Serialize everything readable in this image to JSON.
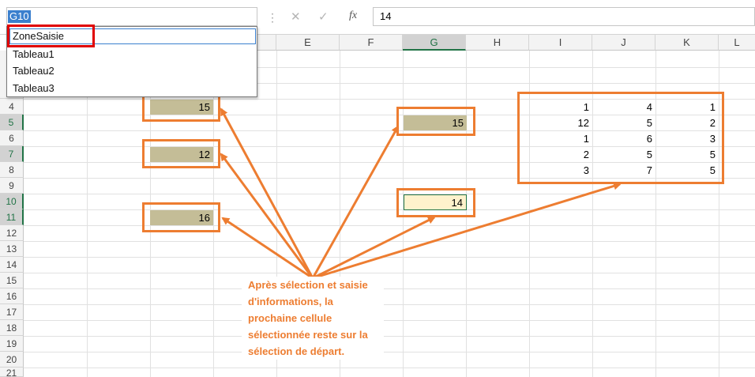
{
  "name_box": {
    "value": "G10"
  },
  "formula_bar": {
    "value": "14",
    "cancel_glyph": "✕",
    "enter_glyph": "✓",
    "fx_label": "fx"
  },
  "name_dropdown": {
    "items": [
      "ZoneSaisie",
      "Tableau1",
      "Tableau2",
      "Tableau3"
    ]
  },
  "columns": [
    "E",
    "F",
    "G",
    "H",
    "I",
    "J",
    "K",
    "L"
  ],
  "rows": [
    "4",
    "5",
    "6",
    "7",
    "8",
    "9",
    "10",
    "11",
    "12",
    "13",
    "14",
    "15",
    "16",
    "17",
    "18",
    "19",
    "20",
    "21"
  ],
  "cells": {
    "c4": "15",
    "c7": "12",
    "c11": "16",
    "g5": "15",
    "g10": "14"
  },
  "table": [
    [
      "1",
      "4",
      "1"
    ],
    [
      "12",
      "5",
      "2"
    ],
    [
      "1",
      "6",
      "3"
    ],
    [
      "2",
      "5",
      "5"
    ],
    [
      "3",
      "7",
      "5"
    ]
  ],
  "callout_text": "Après sélection et saisie d'informations, la prochaine cellule sélectionnée reste sur la sélection de départ.",
  "colors": {
    "accent": "#ed7d31",
    "highlight": "#e00000",
    "fill": "#c4bd97",
    "excel_green": "#217346"
  }
}
